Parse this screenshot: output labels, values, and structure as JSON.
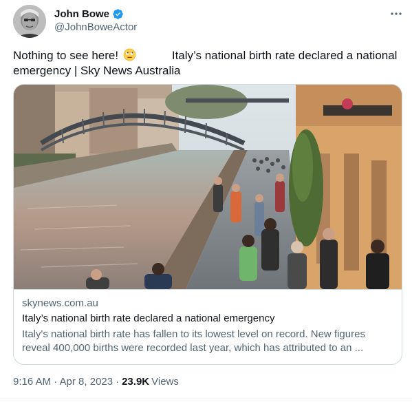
{
  "author": {
    "display_name": "John Bowe",
    "handle": "@JohnBoweActor",
    "verified": true,
    "avatar_icon": "grayscale-portrait-avatar",
    "verified_color": "#1d9bf0"
  },
  "menu": {
    "icon": "more-options-icon"
  },
  "tweet": {
    "text_part1": "Nothing to see here!",
    "emoji": "rolling-eyes-emoji",
    "text_part2": "Italy’s national birth rate declared a national emergency | Sky News Australia"
  },
  "card": {
    "image": "milan-canal-crowd-photo",
    "domain": "skynews.com.au",
    "title": "Italy’s national birth rate declared a national emergency",
    "description": "Italy's national birth rate has fallen to its lowest level on record. New figures reveal 400,000 births were recorded last year, which has attributed to an ..."
  },
  "footer": {
    "time": "9:16 AM · Apr 8, 2023",
    "separator": "·",
    "views_count": "23.9K",
    "views_label": "Views"
  },
  "colors": {
    "text_primary": "#0f1419",
    "text_secondary": "#536471",
    "border": "#cfd9de",
    "accent": "#1d9bf0"
  }
}
